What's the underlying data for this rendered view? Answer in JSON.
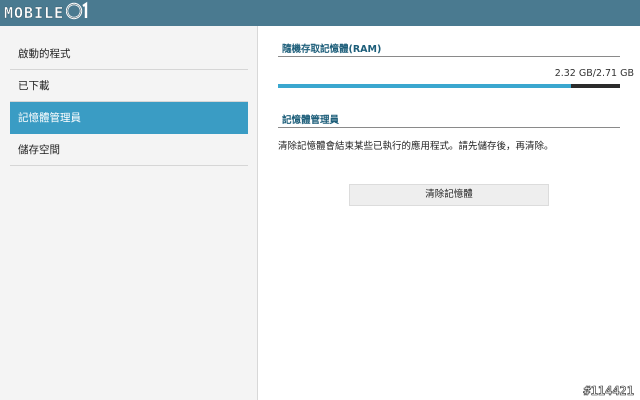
{
  "header": {
    "logo_text": "MOBILE",
    "logo_icon": "mobile01-01-icon"
  },
  "sidebar": {
    "items": [
      {
        "label": "啟動的程式",
        "active": false
      },
      {
        "label": "已下載",
        "active": false
      },
      {
        "label": "記憶體管理員",
        "active": true
      },
      {
        "label": "儲存空間",
        "active": false
      }
    ]
  },
  "ram": {
    "title": "隨機存取記憶體(RAM)",
    "value": "2.32 GB/2.71 GB",
    "used_fraction": 0.856
  },
  "memory_manager": {
    "title": "記憶體管理員",
    "description": "清除記憶體會結束某些已執行的應用程式。請先儲存後，再清除。",
    "clear_button": "清除記憶體"
  },
  "watermark": "#114421",
  "colors": {
    "header": "#4a7a90",
    "accent": "#3a9cc4",
    "bar_fill": "#3aa7cf",
    "bar_track": "#2b2b2b"
  }
}
